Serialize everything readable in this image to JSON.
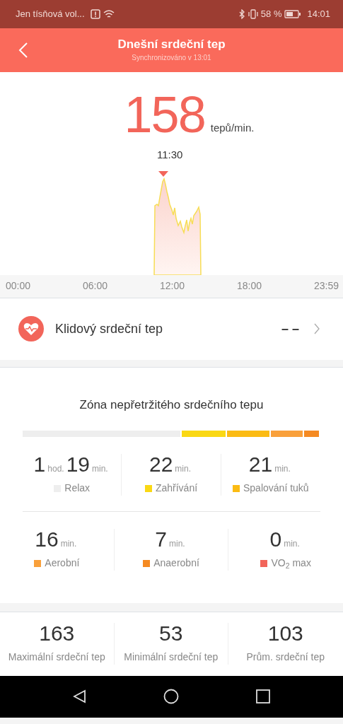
{
  "status_bar": {
    "carrier": "Jen tísňová vol...",
    "battery": "58 %",
    "time": "14:01"
  },
  "header": {
    "title": "Dnešní srdeční tep",
    "subtitle": "Synchronizováno v 13:01"
  },
  "current": {
    "value": "158",
    "unit": "tepů/min.",
    "time": "11:30"
  },
  "chart": {
    "x_labels": [
      "00:00",
      "06:00",
      "12:00",
      "18:00",
      "23:59"
    ]
  },
  "resting": {
    "label": "Klidový srdeční tep",
    "value": "– –"
  },
  "zones": {
    "title": "Zóna nepřetržitého srdečního tepu",
    "items": [
      {
        "parts": [
          {
            "n": "1",
            "u": "hod."
          },
          {
            "n": "19",
            "u": "min."
          }
        ],
        "label": "Relax",
        "color": "#eeeeee"
      },
      {
        "parts": [
          {
            "n": "22",
            "u": "min."
          }
        ],
        "label": "Zahřívání",
        "color": "#fad814"
      },
      {
        "parts": [
          {
            "n": "21",
            "u": "min."
          }
        ],
        "label": "Spalování tuků",
        "color": "#fbbb13"
      },
      {
        "parts": [
          {
            "n": "16",
            "u": "min."
          }
        ],
        "label": "Aerobní",
        "color": "#f9a03b"
      },
      {
        "parts": [
          {
            "n": "7",
            "u": "min."
          }
        ],
        "label": "Anaerobní",
        "color": "#f58a22"
      },
      {
        "parts": [
          {
            "n": "0",
            "u": "min."
          }
        ],
        "label": "VO$_{2}$ max",
        "color": "#f2655a"
      }
    ]
  },
  "stats": [
    {
      "value": "163",
      "label": "Maximální srdeční tep"
    },
    {
      "value": "53",
      "label": "Minimální srdeční tep"
    },
    {
      "value": "103",
      "label": "Prům. srdeční tep"
    }
  ]
}
